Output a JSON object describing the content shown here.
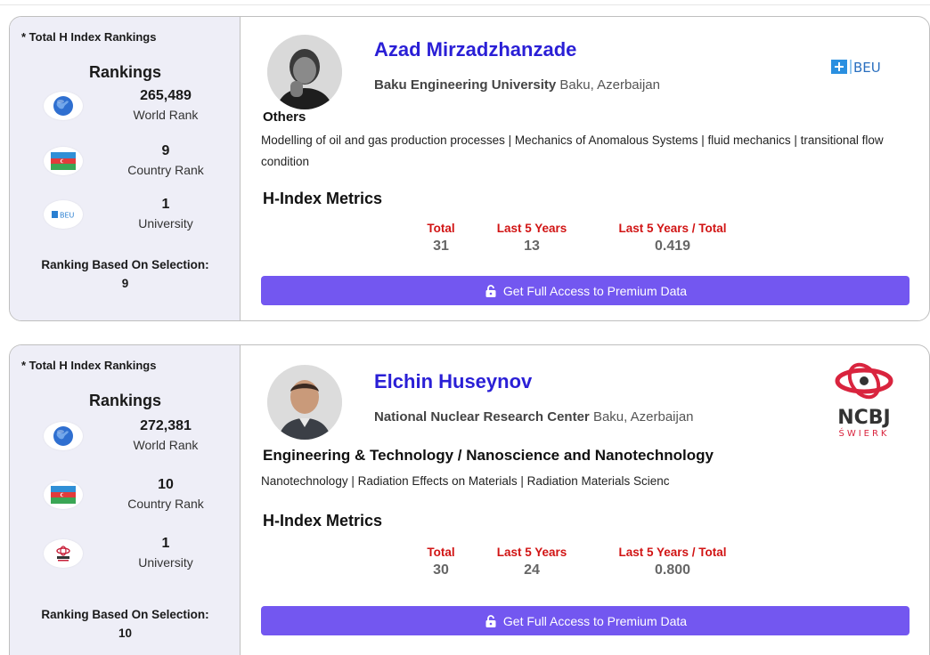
{
  "cards": [
    {
      "sidebar": {
        "title": "* Total H Index Rankings",
        "heading": "Rankings",
        "world_rank": "265,489",
        "world_label": "World Rank",
        "country_rank": "9",
        "country_label": "Country Rank",
        "university_rank": "1",
        "university_label": "University",
        "basis_label": "Ranking Based On Selection:",
        "basis_value": "9"
      },
      "name": "Azad Mirzadzhanzade",
      "institution": "Baku Engineering University",
      "location": "Baku, Azerbaijan",
      "logo_text": "BEU",
      "field": "Others",
      "topics": "Modelling of oil and gas production processes | Mechanics of Anomalous Systems | fluid mechanics | transitional flow condition",
      "metrics_title": "H-Index Metrics",
      "metrics": {
        "total_label": "Total",
        "total": "31",
        "last5_label": "Last 5 Years",
        "last5": "13",
        "ratio_label": "Last 5 Years / Total",
        "ratio": "0.419"
      },
      "cta_label": "Get Full Access to Premium Data"
    },
    {
      "sidebar": {
        "title": "* Total H Index Rankings",
        "heading": "Rankings",
        "world_rank": "272,381",
        "world_label": "World Rank",
        "country_rank": "10",
        "country_label": "Country Rank",
        "university_rank": "1",
        "university_label": "University",
        "basis_label": "Ranking Based On Selection:",
        "basis_value": "10"
      },
      "name": "Elchin Huseynov",
      "institution": "National Nuclear Research Center",
      "location": "Baku, Azerbaijan",
      "logo_text": "NCBJ",
      "logo_subtext": "ŚWIERK",
      "field": "Engineering & Technology / Nanoscience and Nanotechnology",
      "topics": "Nanotechnology | Radiation Effects on Materials | Radiation Materials Scienc",
      "metrics_title": "H-Index Metrics",
      "metrics": {
        "total_label": "Total",
        "total": "30",
        "last5_label": "Last 5 Years",
        "last5": "24",
        "ratio_label": "Last 5 Years / Total",
        "ratio": "0.800"
      },
      "cta_label": "Get Full Access to Premium Data"
    }
  ],
  "colors": {
    "name": "#2a1fd6",
    "metric_header": "#d11414",
    "cta": "#7357f0",
    "sidebar_bg": "#eeeef7"
  },
  "icons": [
    "globe-icon",
    "azerbaijan-flag-icon",
    "university-logo-icon",
    "unlock-icon"
  ]
}
